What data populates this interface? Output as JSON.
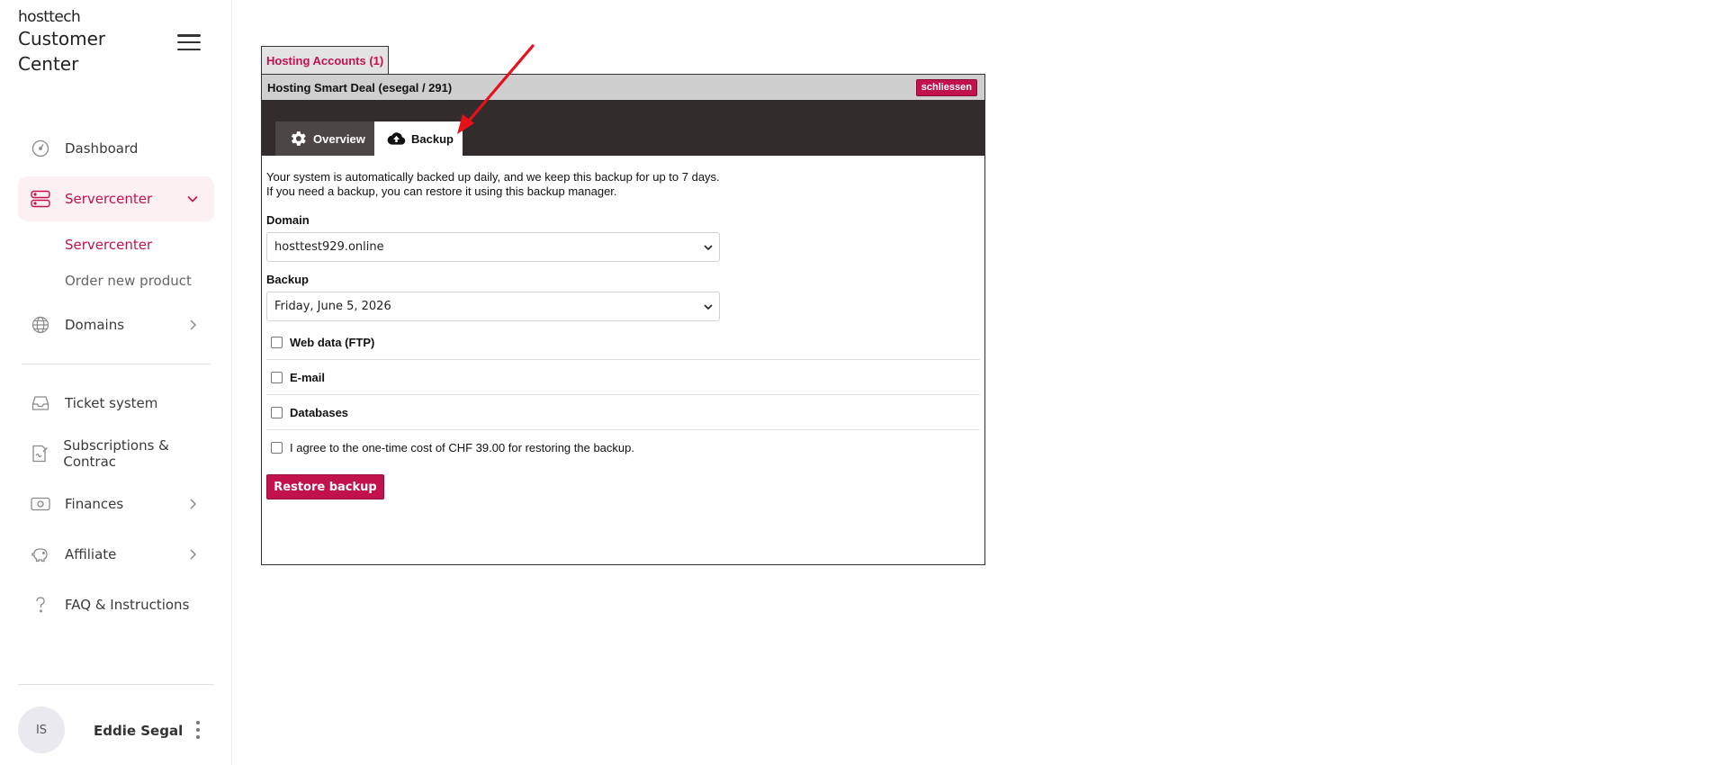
{
  "brand": {
    "logo": "hosttech",
    "title": "Customer Center"
  },
  "sidebar": {
    "items": [
      {
        "label": "Dashboard",
        "icon": "gauge-icon"
      },
      {
        "label": "Servercenter",
        "icon": "server-icon",
        "expanded": true,
        "active": true
      },
      {
        "label": "Domains",
        "icon": "globe-icon"
      },
      {
        "label": "Ticket system",
        "icon": "inbox-icon"
      },
      {
        "label": "Subscriptions & Contrac",
        "icon": "contract-icon"
      },
      {
        "label": "Finances",
        "icon": "money-icon"
      },
      {
        "label": "Affiliate",
        "icon": "piggy-bank-icon"
      },
      {
        "label": "FAQ & Instructions",
        "icon": "question-icon"
      }
    ],
    "subitems": [
      {
        "label": "Servercenter",
        "active": true
      },
      {
        "label": "Order new product"
      }
    ]
  },
  "user": {
    "initials": "IS",
    "name": "Eddie Segal"
  },
  "panel": {
    "outer_tab": "Hosting Accounts (1)",
    "title": "Hosting Smart Deal (esegal / 291)",
    "close_label": "schliessen",
    "tabs": [
      {
        "label": "Overview",
        "icon": "gear-icon"
      },
      {
        "label": "Backup",
        "icon": "cloud-upload-icon",
        "active": true
      }
    ],
    "intro_line1": "Your system is automatically backed up daily, and we keep this backup for up to 7 days.",
    "intro_line2": "If you need a backup, you can restore it using this backup manager.",
    "domain_label": "Domain",
    "domain_value": "hosttest929.online",
    "backup_label": "Backup",
    "backup_value": "Friday, June 5, 2026",
    "options": [
      {
        "label": "Web data (FTP)",
        "checked": false
      },
      {
        "label": "E-mail",
        "checked": false
      },
      {
        "label": "Databases",
        "checked": false
      }
    ],
    "agree_label": "I agree to the one-time cost of CHF 39.00 for restoring the backup.",
    "restore_label": "Restore backup"
  },
  "colors": {
    "accent": "#c2124d",
    "active_bg": "#fdf0f3",
    "dark_band": "#322c2c",
    "panel_head": "#cfcfcf",
    "annotation_arrow": "#e8101a"
  }
}
